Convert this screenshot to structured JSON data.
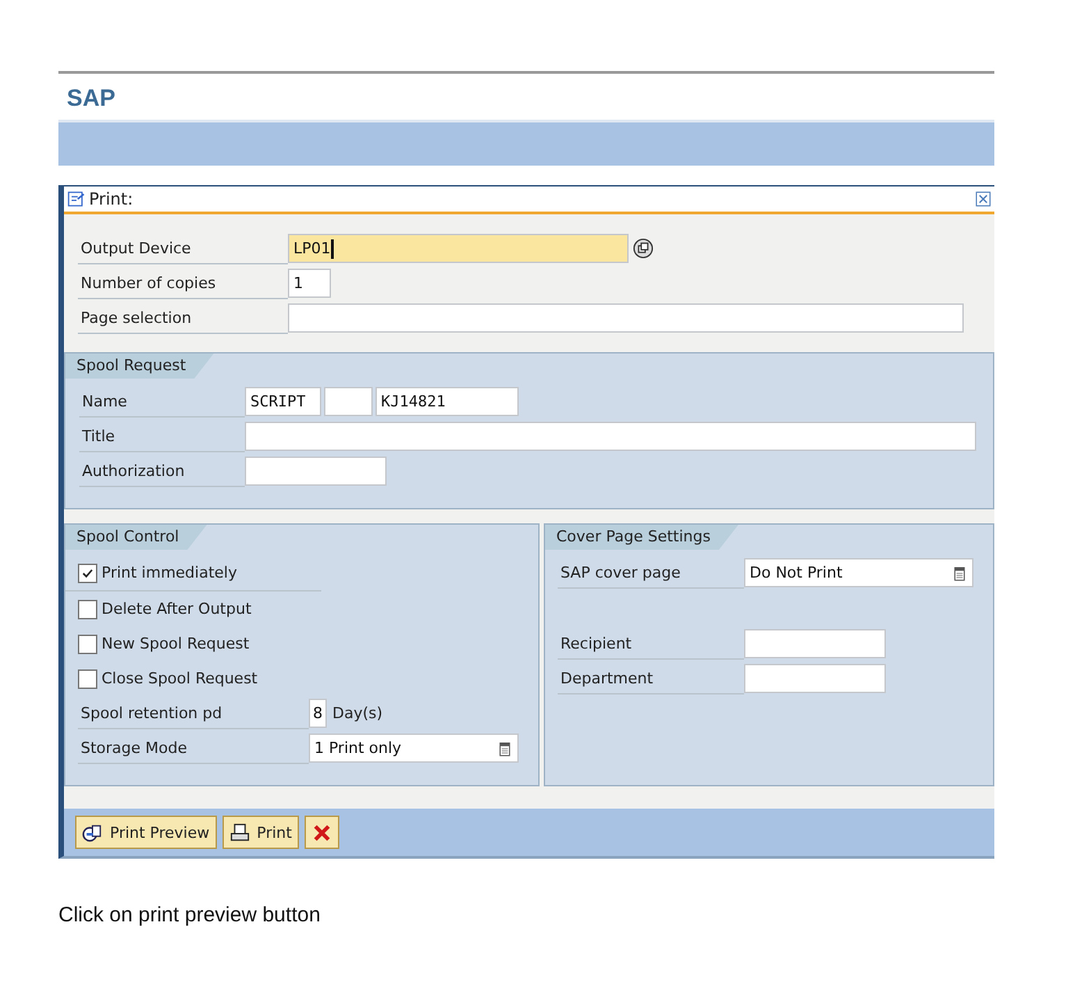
{
  "app_title": "SAP",
  "dialog": {
    "title": "Print:"
  },
  "output_fields": [
    {
      "kind": "device",
      "label": "Output Device",
      "value": "LP01",
      "focused": true
    },
    {
      "kind": "short",
      "label": "Number of copies",
      "value": "1",
      "focused": false
    },
    {
      "kind": "long",
      "label": "Page selection",
      "focused": false
    }
  ],
  "spool_request": {
    "title": "Spool Request",
    "name_label": "Name",
    "name_parts": [
      "SCRIPT",
      "KJ14821"
    ],
    "fields": [
      {
        "kind": "long",
        "label": "Title"
      },
      {
        "kind": "medium",
        "label": "Authorization"
      }
    ]
  },
  "spool_control": {
    "title": "Spool Control",
    "checkboxes": [
      {
        "label": "Print immediately",
        "checked": true
      },
      {
        "label": "Delete After Output",
        "checked": false
      },
      {
        "label": "New Spool Request",
        "checked": false
      },
      {
        "label": "Close Spool Request",
        "checked": false
      }
    ],
    "retention": {
      "label": "Spool retention pd",
      "value": "8",
      "unit": "Day(s)"
    },
    "storage": {
      "label": "Storage Mode",
      "value": "1 Print only"
    }
  },
  "cover_page": {
    "title": "Cover Page Settings",
    "cover": {
      "label": "SAP cover page",
      "value": "Do Not Print"
    },
    "fields": [
      {
        "label": "Recipient"
      },
      {
        "label": "Department"
      }
    ]
  },
  "buttons": [
    {
      "kind": "preview",
      "label": "Print Preview"
    },
    {
      "kind": "print",
      "label": "Print"
    },
    {
      "kind": "cancel"
    }
  ],
  "caption": "Click on print preview button"
}
